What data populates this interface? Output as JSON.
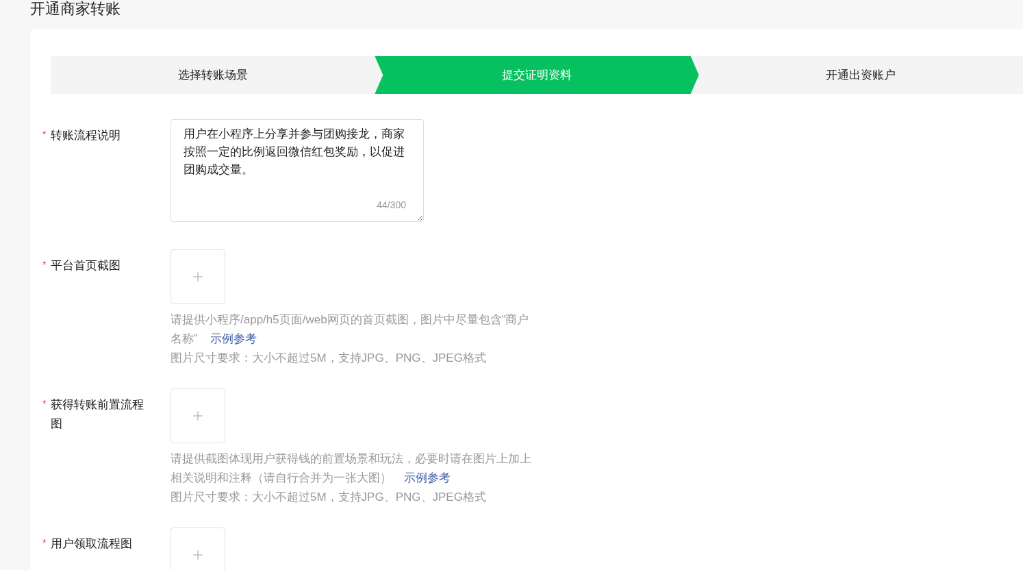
{
  "page_title": "开通商家转账",
  "steps": [
    {
      "label": "选择转账场景",
      "selected": false
    },
    {
      "label": "提交证明资料",
      "selected": true
    },
    {
      "label": "开通出资账户",
      "selected": false
    }
  ],
  "fields": [
    {
      "kind": "textarea",
      "mark": "*",
      "label": "转账流程说明",
      "value": "用户在小程序上分享并参与团购接龙，商家按照一定的比例返回微信红包奖励，以促进团购成交量。",
      "counter": "44/300"
    },
    {
      "kind": "upload",
      "mark": "*",
      "label": "平台首页截图",
      "hint": "请提供小程序/app/h5页面/web网页的首页截图，图片中尽量包含“商户名称”",
      "link": "示例参考",
      "requirement": "图片尺寸要求：大小不超过5M，支持JPG、PNG、JPEG格式"
    },
    {
      "kind": "upload",
      "mark": "*",
      "label": "获得转账前置流程图",
      "hint": "请提供截图体现用户获得钱的前置场景和玩法，必要时请在图片上加上相关说明和注释（请自行合并为一张大图）",
      "link": "示例参考",
      "requirement": "图片尺寸要求：大小不超过5M，支持JPG、PNG、JPEG格式"
    },
    {
      "kind": "upload",
      "mark": "*",
      "label": "用户领取流程图"
    }
  ]
}
